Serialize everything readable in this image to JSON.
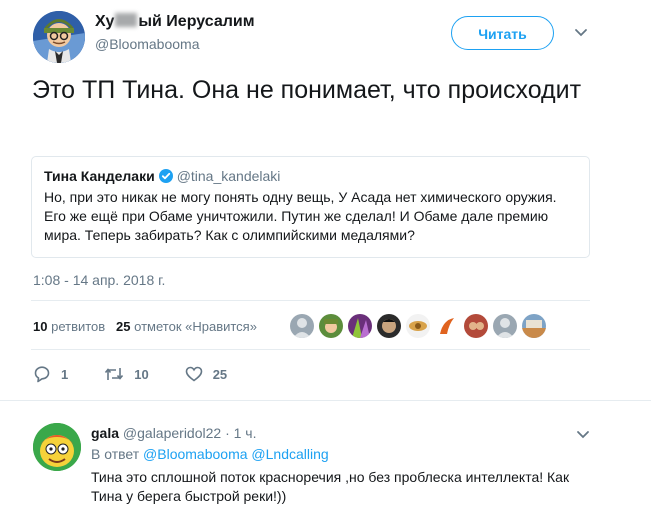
{
  "tweet": {
    "author_name_prefix": "Ху",
    "author_name_suffix": "ый Иерусалим",
    "author_handle": "@Bloomabooma",
    "follow_label": "Читать",
    "text": "Это ТП Тина. Она не понимает, что происходит",
    "timestamp": "1:08 - 14 апр. 2018 г.",
    "retweets_count": "10",
    "retweets_label": "ретвитов",
    "likes_count": "25",
    "likes_label": "отметок «Нравится»",
    "reply_count": "1",
    "retweet_action_count": "10",
    "like_action_count": "25"
  },
  "quote": {
    "name": "Тина Канделаки",
    "handle": "@tina_kandelaki",
    "text": "Но, при это никак не могу понять одну вещь, У Асада нет химического оружия. Его же ещё при Обаме уничтожили. Путин же сделал! И Обаме дале премию мира. Теперь забирать? Как с олимпийскими медалями?"
  },
  "reply": {
    "name": "gala",
    "handle": "@galaperidol22",
    "time": "· 1 ч.",
    "reply_to_label": "В ответ",
    "mention_1": "@Bloomabooma",
    "mention_2": "@Lndcalling",
    "text": "Тина это сплошной поток красноречия ,но без проблеска интеллекта! Как Тина у берега быстрой реки!))"
  },
  "icons": {
    "verified": "verified-badge-icon",
    "caret": "chevron-down-icon",
    "reply": "reply-icon",
    "retweet": "retweet-icon",
    "like": "heart-icon"
  },
  "colors": {
    "accent": "#1da1f2",
    "muted": "#657786",
    "text": "#14171a",
    "border": "#e1e8ed"
  }
}
